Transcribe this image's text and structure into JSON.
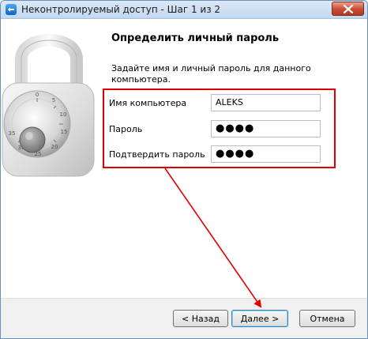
{
  "window": {
    "title": "Неконтролируемый доступ - Шаг 1 из 2"
  },
  "page": {
    "heading": "Определить личный пароль",
    "description": "Задайте имя и личный пароль для данного компьютера."
  },
  "form": {
    "computer_name": {
      "label": "Имя компьютера",
      "value": "ALEKS"
    },
    "password": {
      "label": "Пароль",
      "value": "●●●●"
    },
    "confirm_password": {
      "label": "Подтвердить пароль",
      "value": "●●●●"
    }
  },
  "buttons": {
    "back": "< Назад",
    "next": "Далее >",
    "cancel": "Отмена"
  },
  "colors": {
    "highlight": "#e00000",
    "title_bar": "#c2d7ef",
    "close_button": "#c94a30"
  },
  "icons": [
    "app-icon",
    "close-icon",
    "padlock-image"
  ]
}
